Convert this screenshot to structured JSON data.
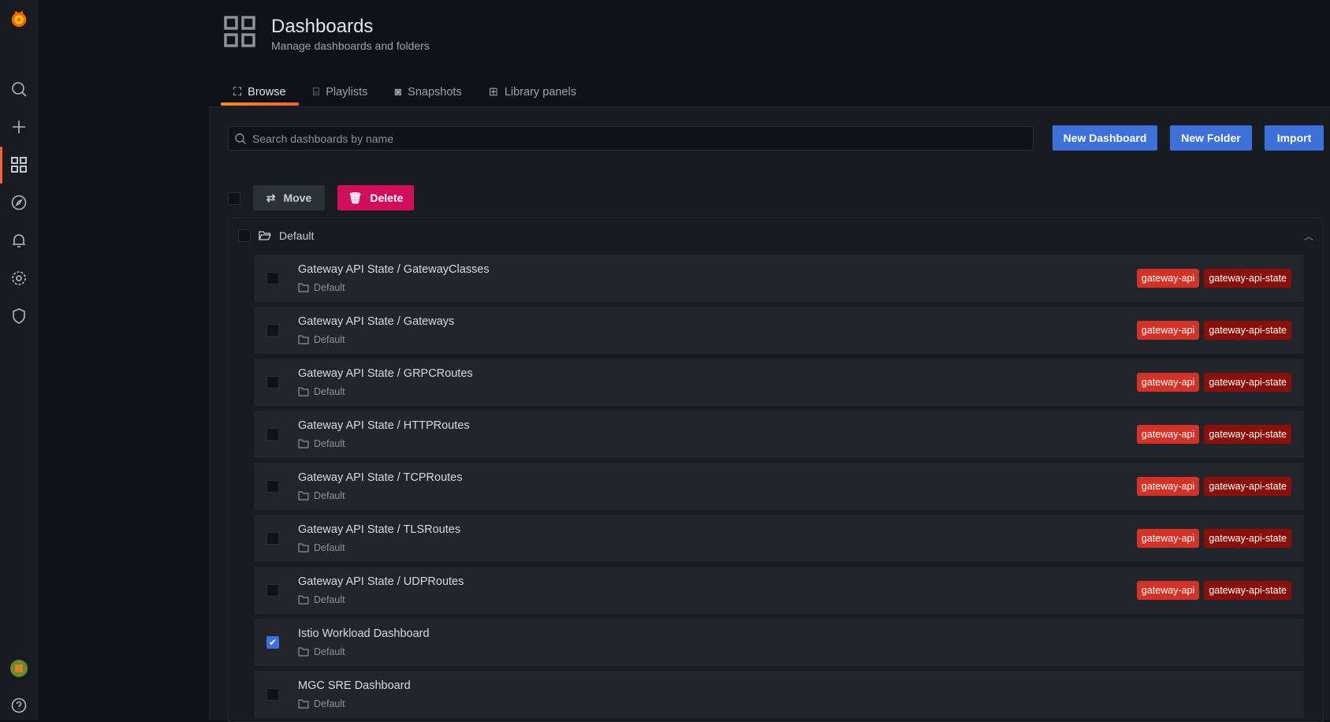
{
  "header": {
    "title": "Dashboards",
    "subtitle": "Manage dashboards and folders"
  },
  "tabs": [
    {
      "label": "Browse",
      "icon": "sitemap-icon",
      "active": true
    },
    {
      "label": "Playlists",
      "icon": "presentation-icon"
    },
    {
      "label": "Snapshots",
      "icon": "camera-icon"
    },
    {
      "label": "Library panels",
      "icon": "library-panel-icon"
    }
  ],
  "search": {
    "placeholder": "Search dashboards by name",
    "value": ""
  },
  "actions": {
    "new_dashboard": "New Dashboard",
    "new_folder": "New Folder",
    "import": "Import",
    "move": "Move",
    "delete": "Delete"
  },
  "folder": {
    "name": "Default"
  },
  "colors": {
    "accent": "#3d71d9",
    "delete": "#d10e5c",
    "tag1": "#d43226",
    "tag2": "#8b0f09"
  },
  "dashboards": [
    {
      "title": "Gateway API State / GatewayClasses",
      "folder": "Default",
      "tags": [
        "gateway-api",
        "gateway-api-state"
      ],
      "checked": false
    },
    {
      "title": "Gateway API State / Gateways",
      "folder": "Default",
      "tags": [
        "gateway-api",
        "gateway-api-state"
      ],
      "checked": false
    },
    {
      "title": "Gateway API State / GRPCRoutes",
      "folder": "Default",
      "tags": [
        "gateway-api",
        "gateway-api-state"
      ],
      "checked": false
    },
    {
      "title": "Gateway API State / HTTPRoutes",
      "folder": "Default",
      "tags": [
        "gateway-api",
        "gateway-api-state"
      ],
      "checked": false
    },
    {
      "title": "Gateway API State / TCPRoutes",
      "folder": "Default",
      "tags": [
        "gateway-api",
        "gateway-api-state"
      ],
      "checked": false
    },
    {
      "title": "Gateway API State / TLSRoutes",
      "folder": "Default",
      "tags": [
        "gateway-api",
        "gateway-api-state"
      ],
      "checked": false
    },
    {
      "title": "Gateway API State / UDPRoutes",
      "folder": "Default",
      "tags": [
        "gateway-api",
        "gateway-api-state"
      ],
      "checked": false
    },
    {
      "title": "Istio Workload Dashboard",
      "folder": "Default",
      "tags": [],
      "checked": true
    },
    {
      "title": "MGC SRE Dashboard",
      "folder": "Default",
      "tags": [],
      "checked": false
    }
  ]
}
